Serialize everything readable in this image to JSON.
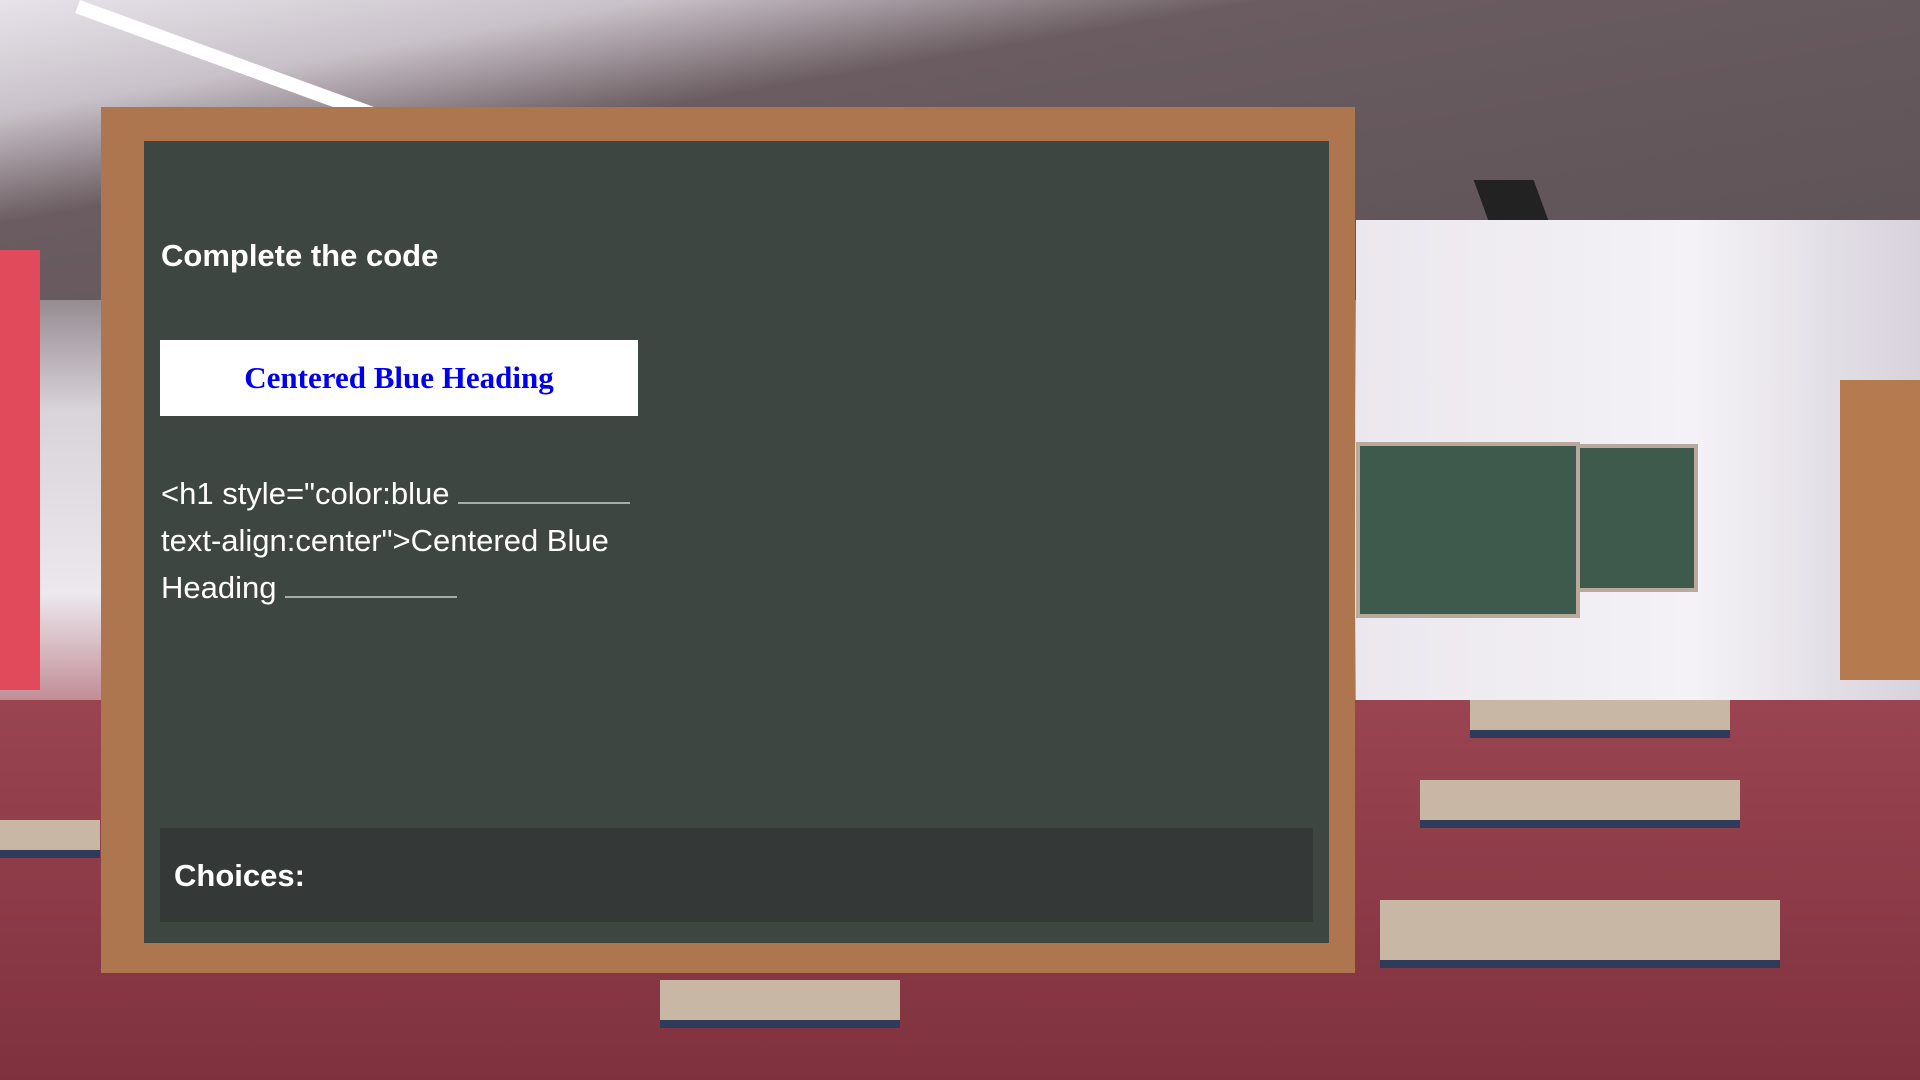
{
  "question": {
    "title": "Complete the code",
    "preview_heading": "Centered Blue Heading",
    "code_line1": "<h1 style=\"color:blue ",
    "code_line2": "text-align:center\">Centered Blue",
    "code_line3": "Heading "
  },
  "choices": {
    "label": "Choices:"
  },
  "colors": {
    "frame": "#ae764e",
    "board": "#3d4641",
    "heading_blue": "#0000ee"
  }
}
